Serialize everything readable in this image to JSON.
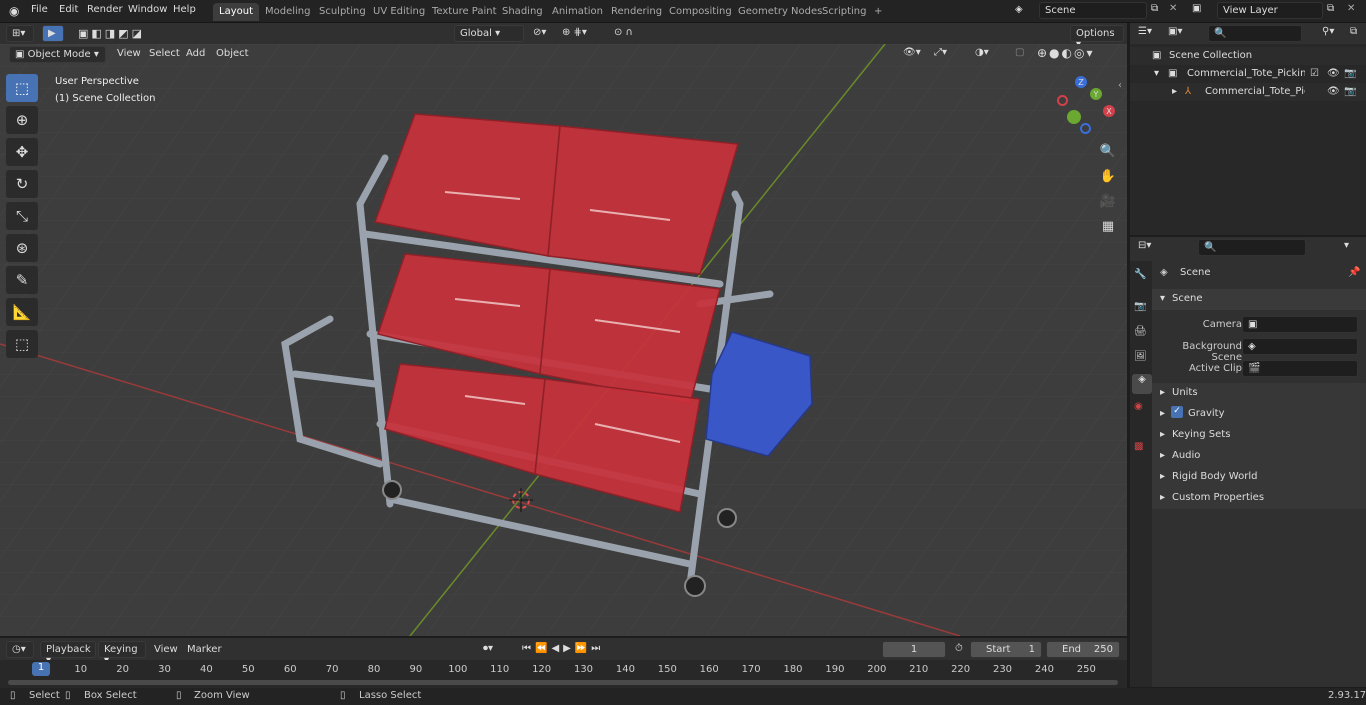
{
  "topbar": {
    "menus": [
      "File",
      "Edit",
      "Render",
      "Window",
      "Help"
    ],
    "tabs": [
      "Layout",
      "Modeling",
      "Sculpting",
      "UV Editing",
      "Texture Paint",
      "Shading",
      "Animation",
      "Rendering",
      "Compositing",
      "Geometry Nodes",
      "Scripting"
    ],
    "add_tab": "+",
    "scene_label": "Scene",
    "view_layer_label": "View Layer"
  },
  "viewport_header": {
    "orientation": "Global",
    "options": "Options",
    "mode": "Object Mode",
    "menus": [
      "View",
      "Select",
      "Add",
      "Object"
    ]
  },
  "viewport": {
    "perspective": "User Perspective",
    "collection": "(1) Scene Collection",
    "gizmo": {
      "x": "X",
      "y": "Y",
      "z": "Z"
    }
  },
  "outliner": {
    "root": "Scene Collection",
    "items": [
      "Commercial_Tote_Picking_Ca",
      "Commercial_Tote_Picking"
    ]
  },
  "properties": {
    "header": "Scene",
    "panel": "Scene",
    "fields": [
      {
        "label": "Camera",
        "value": ""
      },
      {
        "label": "Background Scene",
        "value": ""
      },
      {
        "label": "Active Clip",
        "value": ""
      }
    ],
    "sections": [
      "Units",
      "Gravity",
      "Keying Sets",
      "Audio",
      "Rigid Body World",
      "Custom Properties"
    ]
  },
  "timeline": {
    "menus": [
      "Playback",
      "Keying",
      "View",
      "Marker"
    ],
    "current_frame": "1",
    "start_label": "Start",
    "start": "1",
    "end_label": "End",
    "end": "250",
    "ticks": [
      "1",
      "10",
      "20",
      "30",
      "40",
      "50",
      "60",
      "70",
      "80",
      "90",
      "100",
      "110",
      "120",
      "130",
      "140",
      "150",
      "160",
      "170",
      "180",
      "190",
      "200",
      "210",
      "220",
      "230",
      "240",
      "250"
    ]
  },
  "statusbar": {
    "select": "Select",
    "box_select": "Box Select",
    "zoom_view": "Zoom View",
    "lasso_select": "Lasso Select",
    "version": "2.93.17"
  },
  "colors": {
    "accent": "#4772b3",
    "tote_red": "#c8313b",
    "tote_blue": "#3a57c8",
    "frame": "#9aa3ad"
  }
}
